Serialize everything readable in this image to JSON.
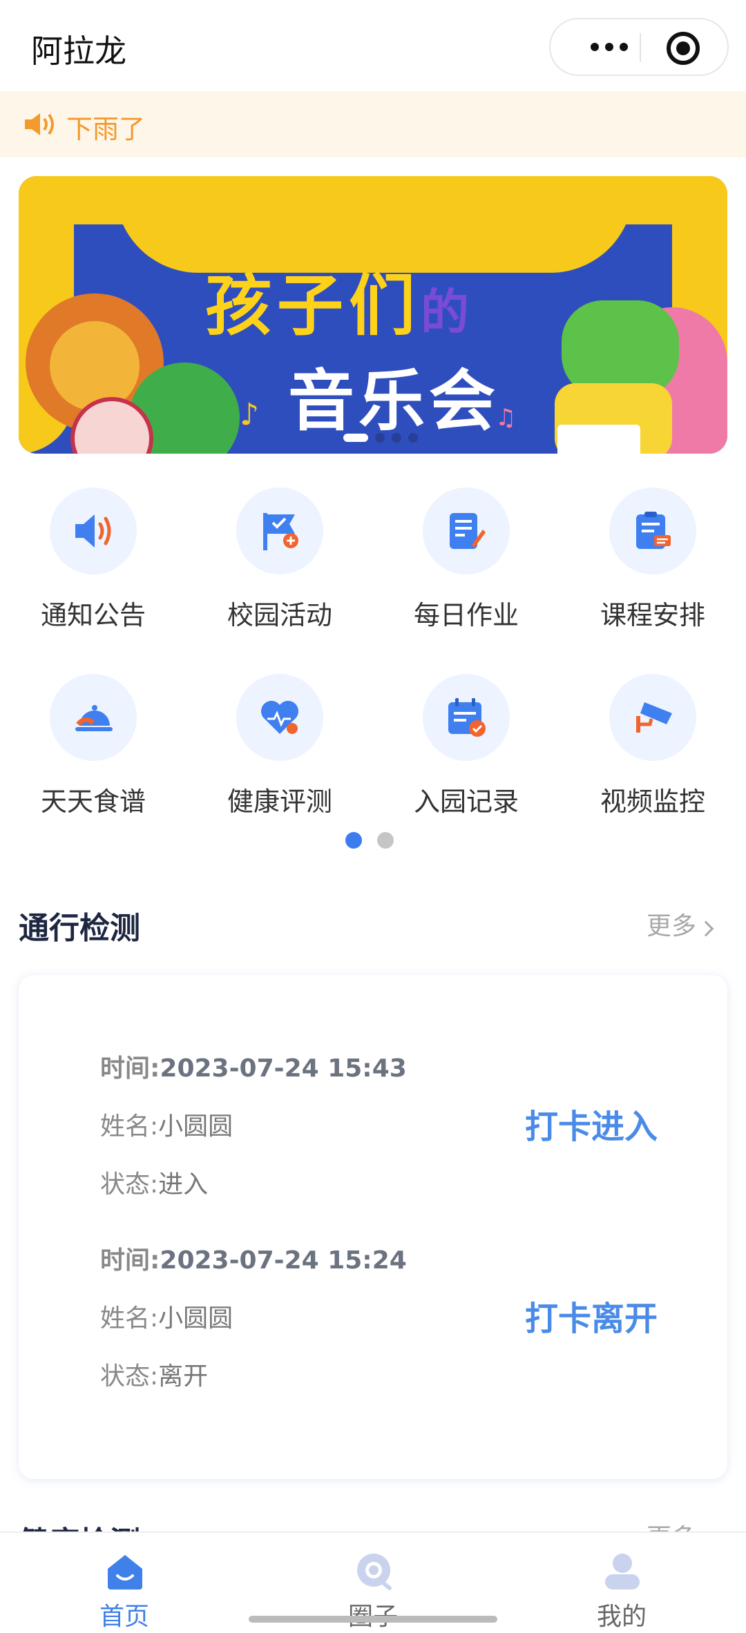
{
  "nav": {
    "title": "阿拉龙"
  },
  "notice": {
    "text": "下雨了"
  },
  "banner": {
    "line1": "孩子们",
    "line1_suffix": "的",
    "line2": "音乐会"
  },
  "grid": {
    "items": [
      {
        "label": "通知公告",
        "icon": "speaker-icon"
      },
      {
        "label": "校园活动",
        "icon": "flag-icon"
      },
      {
        "label": "每日作业",
        "icon": "homework-icon"
      },
      {
        "label": "课程安排",
        "icon": "schedule-icon"
      },
      {
        "label": "天天食谱",
        "icon": "food-icon"
      },
      {
        "label": "健康评测",
        "icon": "heart-icon"
      },
      {
        "label": "入园记录",
        "icon": "calendar-icon"
      },
      {
        "label": "视频监控",
        "icon": "camera-icon"
      }
    ]
  },
  "pass_check": {
    "title": "通行检测",
    "more": "更多",
    "records": [
      {
        "time_label": "时间:",
        "time": "2023-07-24 15:43",
        "name_label": "姓名:",
        "name": "小圆圆",
        "status_label": "状态:",
        "status": "进入",
        "action": "打卡进入"
      },
      {
        "time_label": "时间:",
        "time": "2023-07-24 15:24",
        "name_label": "姓名:",
        "name": "小圆圆",
        "status_label": "状态:",
        "status": "离开",
        "action": "打卡离开"
      }
    ]
  },
  "health_check": {
    "title": "健康检测",
    "more": "更多"
  },
  "tabbar": {
    "tabs": [
      {
        "label": "首页",
        "active": true
      },
      {
        "label": "圈子",
        "active": false
      },
      {
        "label": "我的",
        "active": false
      }
    ]
  },
  "colors": {
    "accent": "#3f80e9",
    "notice_text": "#f29a2b",
    "notice_bg": "#fff6ea"
  }
}
